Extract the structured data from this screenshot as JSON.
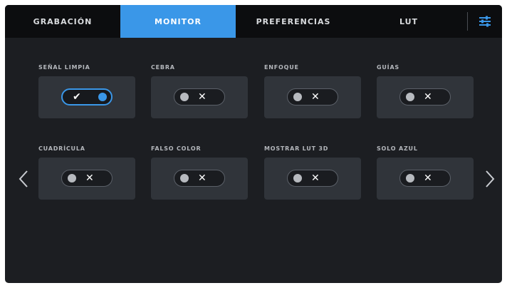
{
  "tabs": [
    {
      "label": "GRABACIÓN",
      "active": false
    },
    {
      "label": "MONITOR",
      "active": true
    },
    {
      "label": "PREFERENCIAS",
      "active": false
    },
    {
      "label": "LUT",
      "active": false
    }
  ],
  "settings_icon": "sliders-icon",
  "toggles": [
    {
      "label": "SEÑAL LIMPIA",
      "state": "on",
      "glyph": "✔"
    },
    {
      "label": "CEBRA",
      "state": "off",
      "glyph": "✕"
    },
    {
      "label": "ENFOQUE",
      "state": "off",
      "glyph": "✕"
    },
    {
      "label": "GUÍAS",
      "state": "off",
      "glyph": "✕"
    },
    {
      "label": "CUADRÍCULA",
      "state": "off",
      "glyph": "✕"
    },
    {
      "label": "FALSO COLOR",
      "state": "off",
      "glyph": "✕"
    },
    {
      "label": "MOSTRAR LUT 3D",
      "state": "off",
      "glyph": "✕"
    },
    {
      "label": "SOLO AZUL",
      "state": "off",
      "glyph": "✕"
    }
  ],
  "nav": {
    "prev_icon": "chevron-left-icon",
    "next_icon": "chevron-right-icon"
  },
  "colors": {
    "accent": "#3a97e8",
    "screen_bg": "#1c1e22",
    "tabbar_bg": "#0c0d0f",
    "tile_bg": "#30343a"
  }
}
